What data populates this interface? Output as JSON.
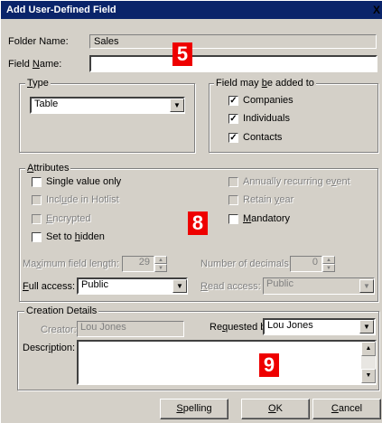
{
  "window": {
    "title": "Add User-Defined Field",
    "close_glyph": "X"
  },
  "folder": {
    "label": "Folder Name:",
    "value": "Sales"
  },
  "field_name": {
    "label_pre": "Field ",
    "label_accel": "N",
    "label_post": "ame:",
    "value": ""
  },
  "type_group": {
    "title_accel": "T",
    "title_rest": "ype",
    "selected": "Table"
  },
  "added_group": {
    "title_pre": "Field may ",
    "title_accel": "b",
    "title_post": "e added to",
    "items": [
      {
        "label": "Companies",
        "checked": true
      },
      {
        "label": "Individuals",
        "checked": true
      },
      {
        "label": "Contacts",
        "checked": true
      }
    ]
  },
  "attributes": {
    "title_accel": "A",
    "title_rest": "ttributes",
    "single_value": {
      "label": "Single value only",
      "checked": false
    },
    "hotlist": {
      "label_pre": "Incl",
      "label_accel": "u",
      "label_post": "de in Hotlist",
      "enabled": false
    },
    "encrypted": {
      "label_pre": "",
      "label_accel": "E",
      "label_post": "ncrypted",
      "enabled": false
    },
    "hidden": {
      "label_pre": "Set to ",
      "label_accel": "h",
      "label_post": "idden",
      "checked": false
    },
    "annual": {
      "label_pre": "Annually recurring e",
      "label_accel": "v",
      "label_post": "ent",
      "enabled": false
    },
    "retain": {
      "label_pre": "Retain ",
      "label_accel": "y",
      "label_post": "ear",
      "enabled": false
    },
    "mandatory": {
      "label_pre": "",
      "label_accel": "M",
      "label_post": "andatory",
      "checked": false
    },
    "max_len": {
      "label_pre": "Ma",
      "label_accel": "x",
      "label_post": "imum field length:",
      "value": "29"
    },
    "decimals": {
      "label": "Number of decimals:",
      "value": "0"
    },
    "full_access": {
      "label_pre": "",
      "label_accel": "F",
      "label_post": "ull access:",
      "value": "Public"
    },
    "read_access": {
      "label_pre": "",
      "label_accel": "R",
      "label_post": "ead access:",
      "value": "Public"
    }
  },
  "creation": {
    "title": "Creation Details",
    "creator_label": "Creator:",
    "creator_value": "Lou Jones",
    "requested_label_pre": "Re",
    "requested_label_accel": "q",
    "requested_label_post": "uested by:",
    "requested_value": "Lou Jones",
    "desc_label_pre": "Descr",
    "desc_label_accel": "i",
    "desc_label_post": "ption:",
    "desc_value": ""
  },
  "buttons": {
    "spelling": {
      "pre": "",
      "accel": "S",
      "post": "pelling"
    },
    "ok": {
      "pre": "",
      "accel": "O",
      "post": "K"
    },
    "cancel": {
      "pre": "",
      "accel": "C",
      "post": "ancel"
    }
  },
  "badges": {
    "b5": "5",
    "b8": "8",
    "b9": "9"
  },
  "colors": {
    "titlebar": "#0a246a",
    "badge": "#ee0000",
    "face": "#d4d0c8"
  }
}
